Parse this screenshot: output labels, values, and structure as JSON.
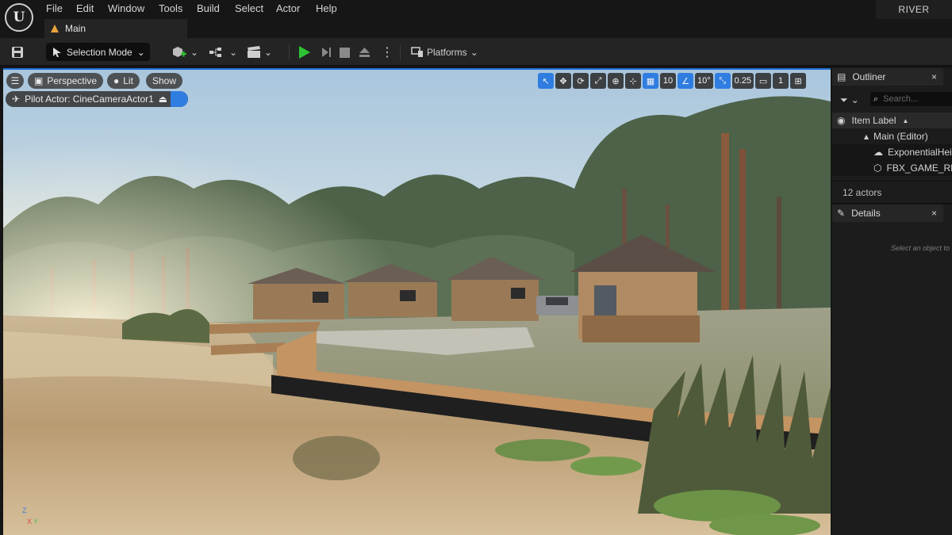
{
  "app": {
    "logo": "U",
    "project": "RIVER"
  },
  "menu": [
    "File",
    "Edit",
    "Window",
    "Tools",
    "Build",
    "Select",
    "Actor",
    "Help"
  ],
  "tabs": [
    {
      "label": "Main"
    }
  ],
  "toolbar": {
    "selection_mode": "Selection Mode",
    "platforms": "Platforms"
  },
  "viewport": {
    "view_mode": "Perspective",
    "lighting": "Lit",
    "show": "Show",
    "pilot": "Pilot Actor: CineCameraActor1",
    "grid_snap": "10",
    "rotation_snap": "10°",
    "scale_snap": "0.25",
    "camera_speed": "1",
    "axes": {
      "z": "Z",
      "x": "X",
      "y": "Y"
    }
  },
  "outliner": {
    "title": "Outliner",
    "close": "×",
    "search_placeholder": "Search...",
    "column_header": "Item Label",
    "items": [
      {
        "label": "Main (Editor)"
      },
      {
        "label": "ExponentialHeightFog"
      },
      {
        "label": "FBX_GAME_READY"
      }
    ],
    "count": "12 actors"
  },
  "details": {
    "title": "Details",
    "close": "×",
    "hint": "Select an object to view details."
  },
  "colors": {
    "accent_blue": "#2f7de0",
    "play_green": "#2ec335",
    "panel_bg": "#1c1c1c"
  }
}
